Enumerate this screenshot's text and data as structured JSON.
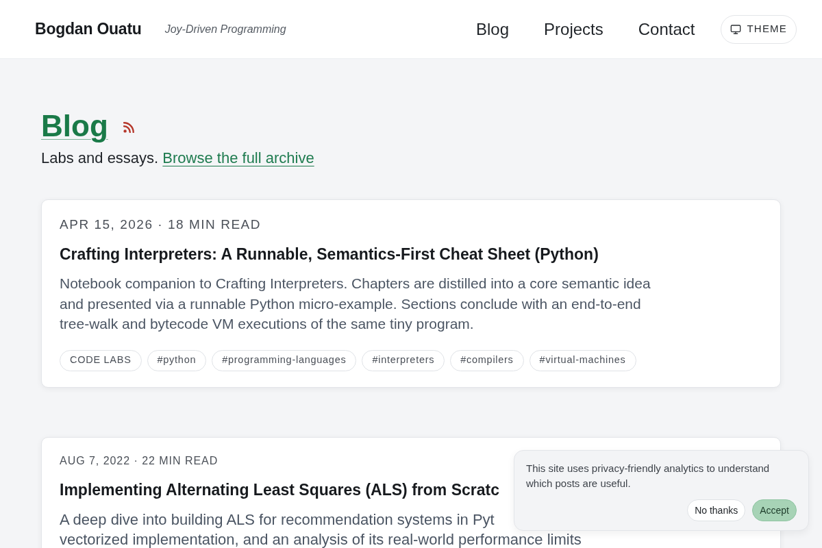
{
  "header": {
    "site_title": "Bogdan Ouatu",
    "tagline": "Joy-Driven Programming",
    "nav": [
      {
        "label": "Blog"
      },
      {
        "label": "Projects"
      },
      {
        "label": "Contact"
      }
    ],
    "theme_button": {
      "label": "THEME"
    }
  },
  "intro": {
    "title": "Blog",
    "text": "Labs and essays.",
    "archive_link": "Browse the full archive"
  },
  "posts": [
    {
      "kind": "lab",
      "meta": "APR 15, 2026 · 18 MIN READ",
      "title": "Crafting Interpreters: A Runnable, Semantics-First Cheat Sheet (Python)",
      "description": "Notebook companion to Crafting Interpreters. Chapters are distilled into a core semantic idea and presented via a runnable Python micro-example. Sections conclude with an end-to-end tree-walk and bytecode VM executions of the same tiny program.",
      "tags": [
        "CODE LABS",
        "#python",
        "#programming-languages",
        "#interpreters",
        "#compilers",
        "#virtual-machines"
      ]
    },
    {
      "kind": "essay",
      "meta": "AUG 7, 2022 · 22 MIN READ",
      "title": "Implementing Alternating Least Squares (ALS) from Scratc",
      "description": "A deep dive into building ALS for recommendation systems in Pyt\nvectorized implementation, and an analysis of its real-world performance limits"
    }
  ],
  "cookie_banner": {
    "message": "This site uses privacy-friendly analytics to understand which posts are useful.",
    "buttons": [
      {
        "kind": "decline",
        "label": "No thanks"
      },
      {
        "kind": "accept",
        "label": "Accept"
      }
    ]
  }
}
